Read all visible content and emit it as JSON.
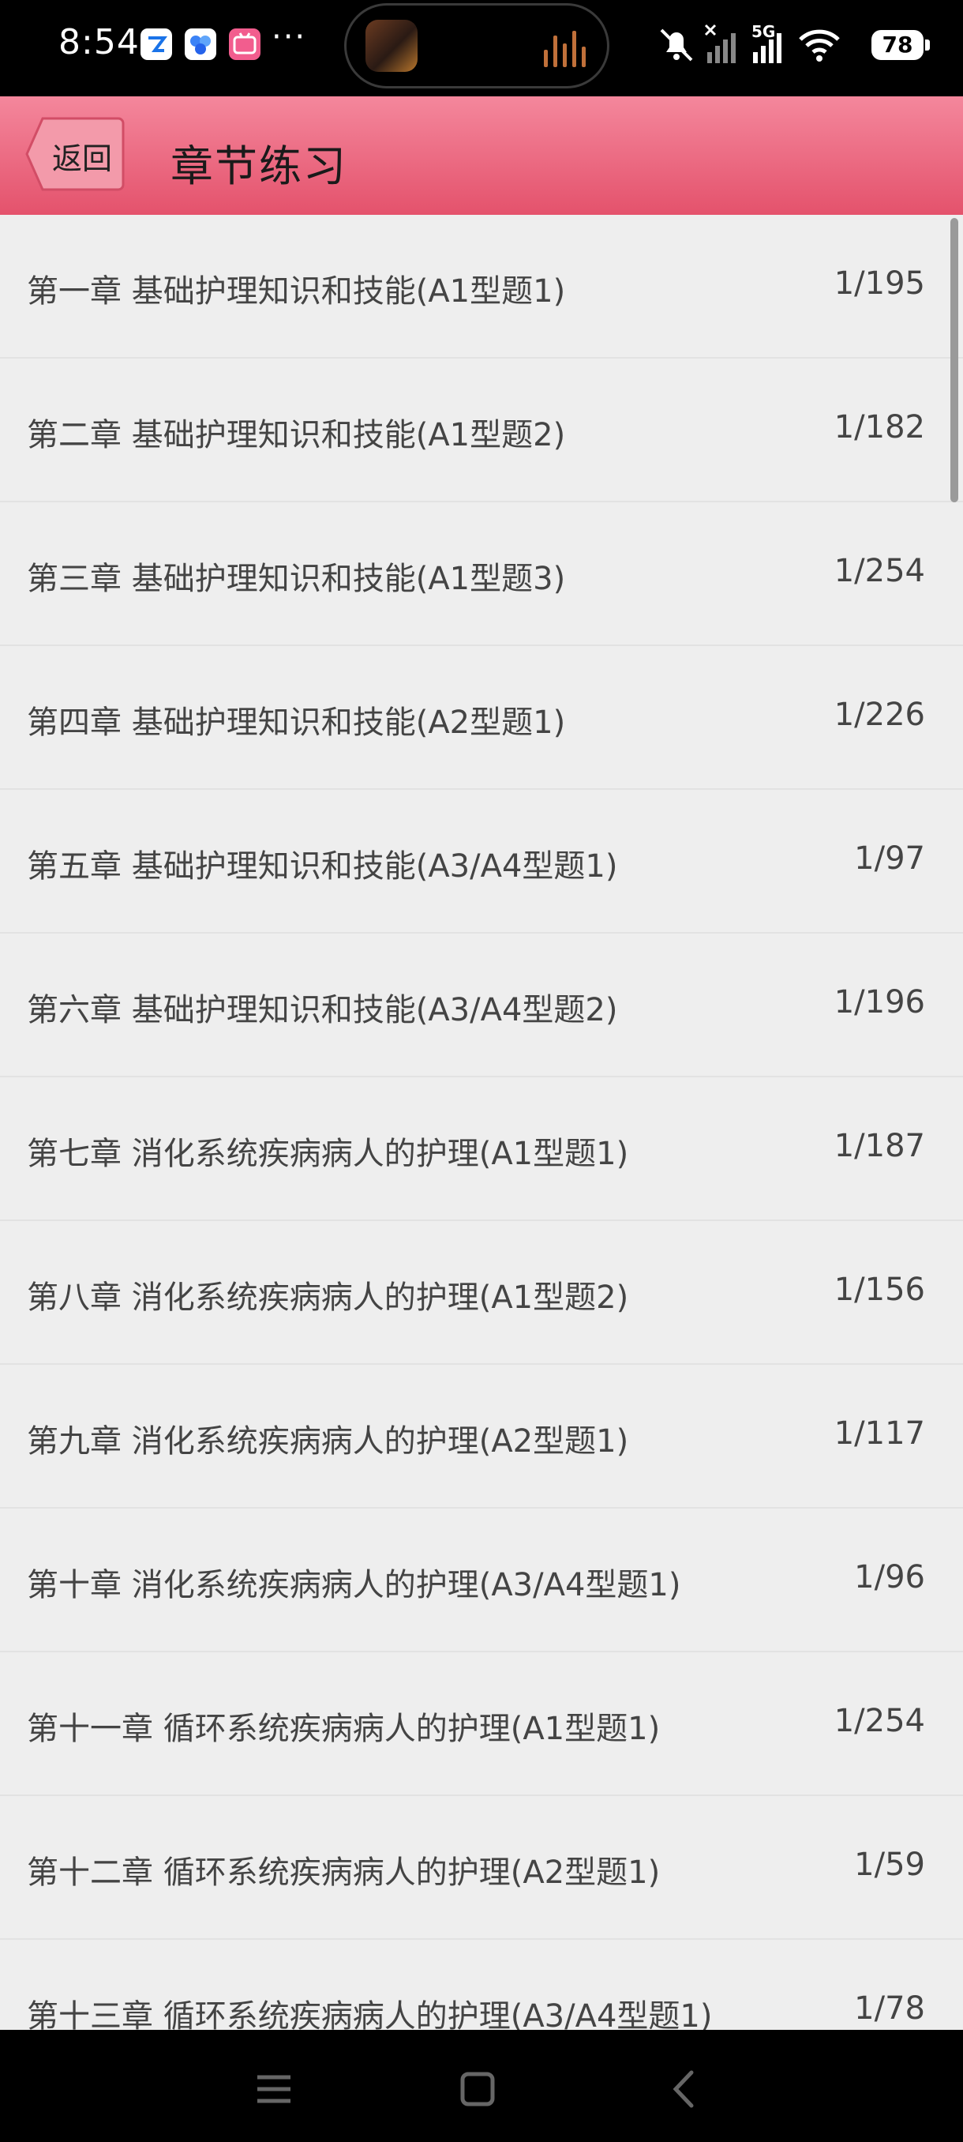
{
  "status_bar": {
    "time": "8:54",
    "more": "···",
    "network": "5G",
    "battery": "78"
  },
  "header": {
    "back_label": "返回",
    "title": "章节练习"
  },
  "chapters": [
    {
      "title": "第一章 基础护理知识和技能(A1型题1)",
      "progress": "1/195"
    },
    {
      "title": "第二章 基础护理知识和技能(A1型题2)",
      "progress": "1/182"
    },
    {
      "title": "第三章 基础护理知识和技能(A1型题3)",
      "progress": "1/254"
    },
    {
      "title": "第四章 基础护理知识和技能(A2型题1)",
      "progress": "1/226"
    },
    {
      "title": "第五章 基础护理知识和技能(A3/A4型题1)",
      "progress": "1/97"
    },
    {
      "title": "第六章 基础护理知识和技能(A3/A4型题2)",
      "progress": "1/196"
    },
    {
      "title": "第七章 消化系统疾病病人的护理(A1型题1)",
      "progress": "1/187"
    },
    {
      "title": "第八章 消化系统疾病病人的护理(A1型题2)",
      "progress": "1/156"
    },
    {
      "title": "第九章 消化系统疾病病人的护理(A2型题1)",
      "progress": "1/117"
    },
    {
      "title": "第十章 消化系统疾病病人的护理(A3/A4型题1)",
      "progress": "1/96"
    },
    {
      "title": "第十一章 循环系统疾病病人的护理(A1型题1)",
      "progress": "1/254"
    },
    {
      "title": "第十二章 循环系统疾病病人的护理(A2型题1)",
      "progress": "1/59"
    },
    {
      "title": "第十三章 循环系统疾病病人的护理(A3/A4型题1)",
      "progress": "1/78"
    }
  ],
  "colors": {
    "header_top": "#f4879c",
    "header_bottom": "#e4526c",
    "list_bg": "#eeeeee"
  },
  "icons": [
    "app-icon-1",
    "app-icon-2",
    "bilibili-icon",
    "mute-icon",
    "signal-icon",
    "wifi-icon",
    "battery-icon",
    "menu-icon",
    "home-icon",
    "back-nav-icon"
  ]
}
